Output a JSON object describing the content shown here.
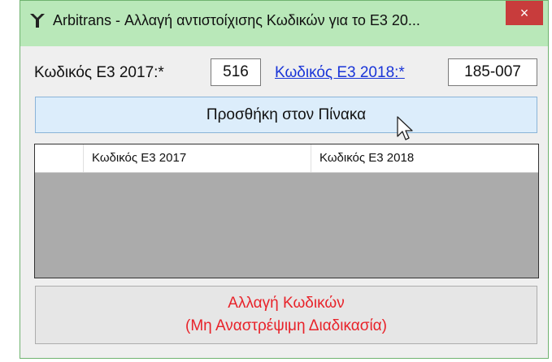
{
  "window": {
    "title": "Arbitrans - Αλλαγή αντιστοίχισης Κωδικών για το Ε3 20...",
    "close_glyph": "×"
  },
  "form": {
    "code2017_label": "Κωδικός Ε3 2017:*",
    "code2017_value": "516",
    "code2018_label": "Κωδικός Ε3 2018:*",
    "code2018_value": "185-007"
  },
  "add_button": {
    "label": "Προσθήκη στον Πίνακα"
  },
  "table": {
    "columns": [
      "",
      "Κωδικός Ε3 2017",
      "Κωδικός Ε3 2018"
    ],
    "rows": []
  },
  "change_button": {
    "line1": "Αλλαγή Κωδικών",
    "line2": "(Μη Αναστρέψιμη Διαδικασία)"
  },
  "colors": {
    "titlebar": "#b9e8b9",
    "close": "#c83c3c",
    "link": "#1a35d8",
    "warning_text": "#e8232a",
    "grid_bg": "#ababab"
  }
}
